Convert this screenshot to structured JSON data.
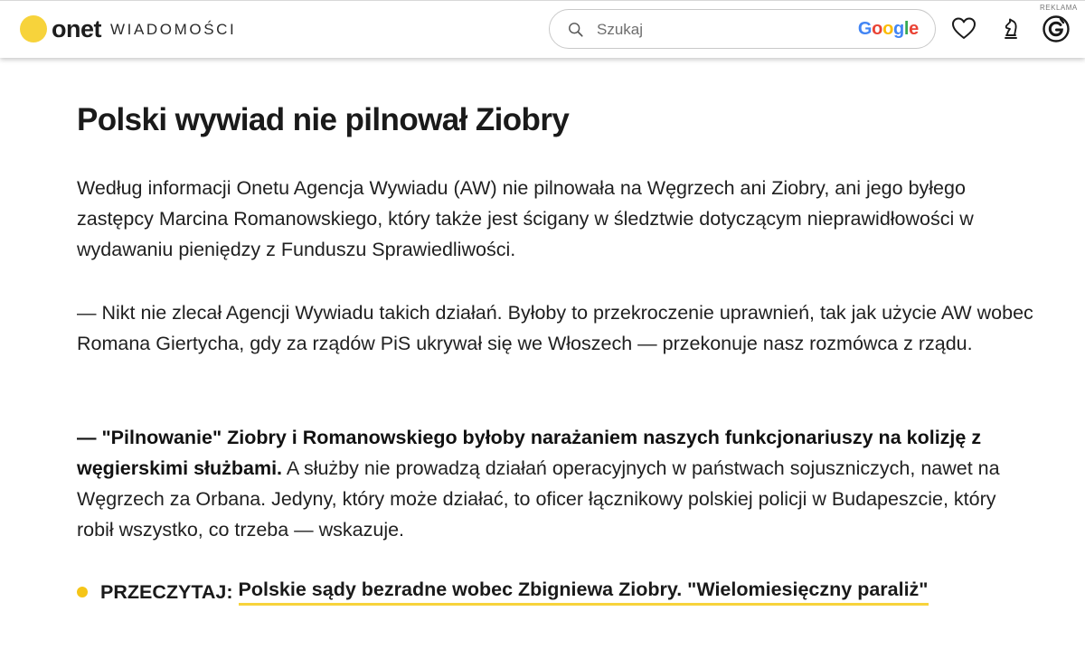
{
  "header": {
    "logo_word": "onet",
    "section": "WIADOMOŚCI",
    "search_placeholder": "Szukaj",
    "google_letters": [
      "G",
      "o",
      "o",
      "g",
      "l",
      "e"
    ],
    "ad_label": "REKLAMA",
    "icons": [
      "search-icon",
      "heart-icon",
      "chess-knight-icon",
      "g-badge-icon"
    ],
    "colors": {
      "brand_yellow": "#f7d33b"
    }
  },
  "article": {
    "title": "Polski wywiad nie pilnował Ziobry",
    "p1": "Według informacji Onetu Agencja Wywiadu (AW) nie pilnowała na Węgrzech ani Ziobry, ani jego byłego zastępcy Marcina Romanowskiego, który także jest ścigany w śledztwie dotyczącym nieprawidłowości w wydawaniu pieniędzy z Funduszu Sprawiedliwości.",
    "p2": "— Nikt nie zlecał Agencji Wywiadu takich działań. Byłoby to przekroczenie uprawnień, tak jak użycie AW wobec Romana Giertycha, gdy za rządów PiS ukrywał się we Włoszech — przekonuje nasz rozmówca z rządu.",
    "p3_bold": "— \"Pilnowanie\" Ziobry i Romanowskiego byłoby narażaniem naszych funkcjonariuszy na kolizję z węgierskimi służbami.",
    "p3_rest": " A służby nie prowadzą działań operacyjnych w państwach sojuszniczych, nawet na Węgrzech za Orbana. Jedyny, który może działać, to oficer łącznikowy polskiej policji w Budapeszcie, który robił wszystko, co trzeba — wskazuje.",
    "read_more_label": "PRZECZYTAJ:",
    "read_more_link": "Polskie sądy bezradne wobec Zbigniewa Ziobry. \"Wielomiesięczny paraliż\""
  }
}
